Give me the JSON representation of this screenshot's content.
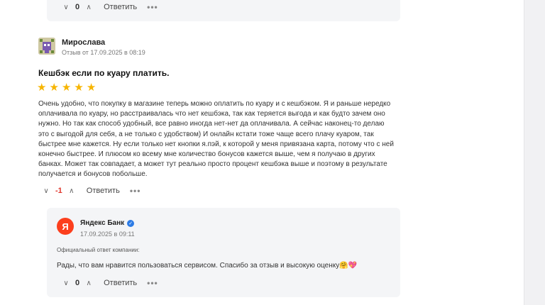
{
  "top_reply": {
    "votes": "0",
    "reply_label": "Ответить",
    "more_label": "•••"
  },
  "review": {
    "author": "Мирослава",
    "meta": "Отзыв от 17.09.2025 в 08:19",
    "title": "Кешбэк если по куару платить.",
    "rating": 5,
    "text": "Очень удобно, что покупку в магазине теперь можно оплатить по куару и с кешбэком. Я и раньше нередко оплачивала по куару, но расстраивалась что нет кешбэка, так как теряется выгода и как будто зачем оно нужно. Но так как способ удобный, все равно иногда нет-нет да оплачивала. А сейчас наконец-то делаю это с выгодой для себя, а не только с удобством) И онлайн кстати тоже чаще всего плачу куаром, так быстрее мне кажется. Ну если только нет кнопки я.пэй, к которой у меня привязана карта, потому что с ней конечно быстрее. И плюсом ко всему мне количество бонусов кажется выше, чем я получаю в других банках. Может так совпадает, а может тут реально просто процент кешбэка выше и поэтому в результате получается и бонусов побольше.",
    "votes": "-1",
    "reply_label": "Ответить",
    "more_label": "•••"
  },
  "company_reply": {
    "logo_letter": "Я",
    "name": "Яндекс Банк",
    "date": "17.09.2025 в 09:11",
    "official_label": "Официальный ответ компании:",
    "text": "Рады, что вам нравится пользоваться сервисом. Спасибо за отзыв и высокую оценку",
    "emoji1": "🤗",
    "emoji2": "💖",
    "votes": "0",
    "reply_label": "Ответить",
    "more_label": "•••"
  },
  "colors": {
    "star": "#f7b500",
    "negative": "#e0352b",
    "brand": "#fc3f1d",
    "verified": "#2c7be5"
  }
}
